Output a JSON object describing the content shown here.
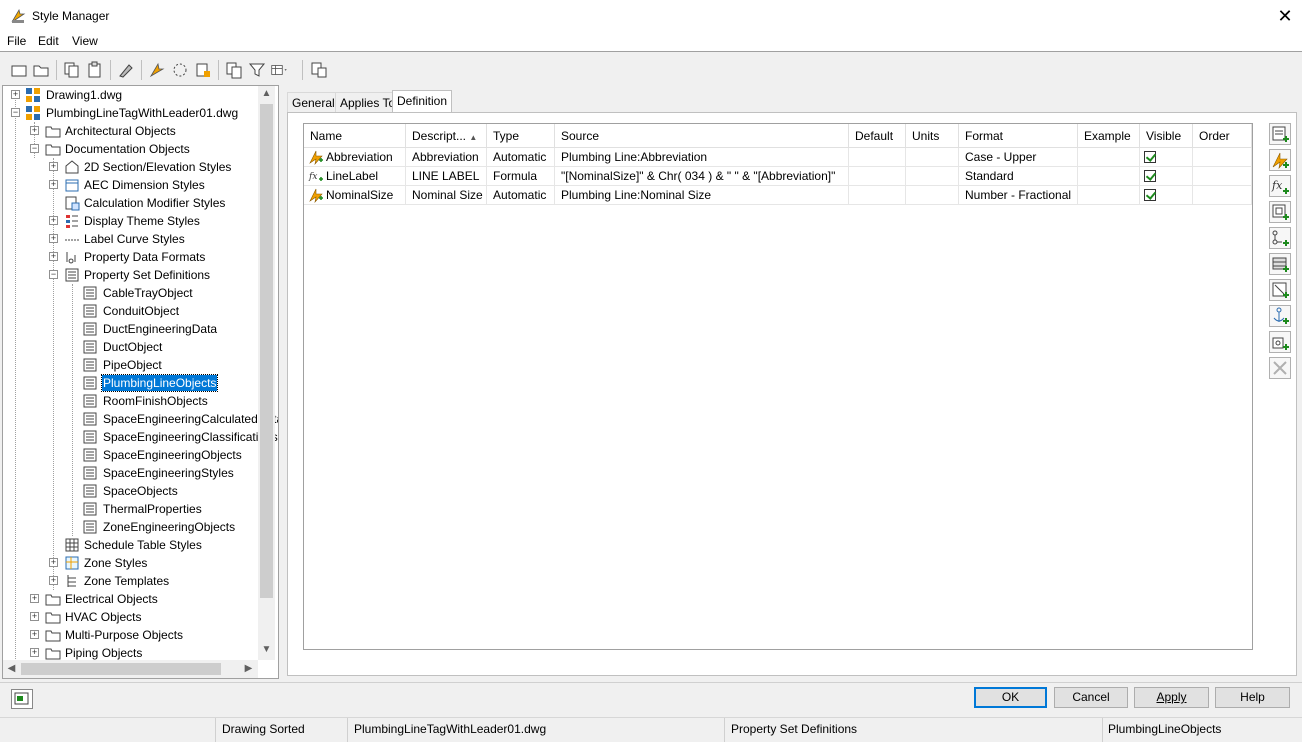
{
  "window": {
    "title": "Style Manager",
    "close": "✕"
  },
  "menu": [
    "File",
    "Edit",
    "View"
  ],
  "tree": {
    "items": [
      {
        "label": "Drawing1.dwg"
      },
      {
        "label": "PlumbingLineTagWithLeader01.dwg"
      },
      {
        "label": "Architectural Objects"
      },
      {
        "label": "Documentation Objects"
      },
      {
        "label": "2D Section/Elevation Styles"
      },
      {
        "label": "AEC Dimension Styles"
      },
      {
        "label": "Calculation Modifier Styles"
      },
      {
        "label": "Display Theme Styles"
      },
      {
        "label": "Label Curve Styles"
      },
      {
        "label": "Property Data Formats"
      },
      {
        "label": "Property Set Definitions"
      },
      {
        "label": "CableTrayObject"
      },
      {
        "label": "ConduitObject"
      },
      {
        "label": "DuctEngineeringData"
      },
      {
        "label": "DuctObject"
      },
      {
        "label": "PipeObject"
      },
      {
        "label": "PlumbingLineObjects"
      },
      {
        "label": "RoomFinishObjects"
      },
      {
        "label": "SpaceEngineeringCalculatedData"
      },
      {
        "label": "SpaceEngineeringClassifications"
      },
      {
        "label": "SpaceEngineeringObjects"
      },
      {
        "label": "SpaceEngineeringStyles"
      },
      {
        "label": "SpaceObjects"
      },
      {
        "label": "ThermalProperties"
      },
      {
        "label": "ZoneEngineeringObjects"
      },
      {
        "label": "Schedule Table Styles"
      },
      {
        "label": "Zone Styles"
      },
      {
        "label": "Zone Templates"
      },
      {
        "label": "Electrical Objects"
      },
      {
        "label": "HVAC Objects"
      },
      {
        "label": "Multi-Purpose Objects"
      },
      {
        "label": "Piping Objects"
      }
    ]
  },
  "tabs": [
    "General",
    "Applies To",
    "Definition"
  ],
  "grid": {
    "columns": [
      "Name",
      "Descript...",
      "Type",
      "Source",
      "Default",
      "Units",
      "Format",
      "Example",
      "Visible",
      "Order"
    ],
    "rows": [
      {
        "name": "Abbreviation",
        "description": "Abbreviation",
        "type": "Automatic",
        "source": "Plumbing Line:Abbreviation",
        "default": "",
        "units": "",
        "format": "Case - Upper",
        "example": "",
        "visible": true,
        "order": ""
      },
      {
        "name": "LineLabel",
        "description": "LINE LABEL",
        "type": "Formula",
        "source": "\"[NominalSize]\" & Chr( 034 ) & \" \" & \"[Abbreviation]\"",
        "default": "",
        "units": "",
        "format": "Standard",
        "example": "",
        "visible": true,
        "order": ""
      },
      {
        "name": "NominalSize",
        "description": "Nominal Size",
        "type": "Automatic",
        "source": "Plumbing Line:Nominal Size",
        "default": "",
        "units": "",
        "format": "Number - Fractional",
        "example": "",
        "visible": true,
        "order": ""
      }
    ]
  },
  "buttons": {
    "ok": "OK",
    "cancel": "Cancel",
    "apply": "Apply",
    "help": "Help"
  },
  "status": {
    "sort": "Drawing Sorted",
    "drawing": "PlumbingLineTagWithLeader01.dwg",
    "category": "Property Set Definitions",
    "style": "PlumbingLineObjects"
  },
  "colors": {
    "selection": "#0078d7",
    "accent_orange": "#f0a000",
    "check": "#1d8a1d"
  }
}
